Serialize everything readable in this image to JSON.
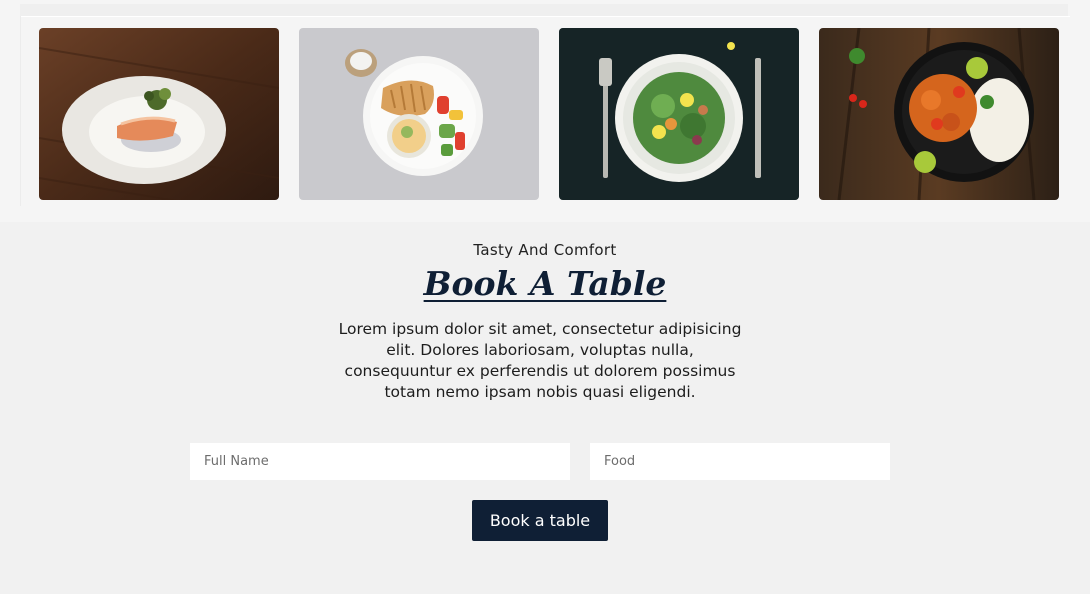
{
  "gallery": {
    "images": [
      {
        "icon": "salmon-dish-photo"
      },
      {
        "icon": "chicken-salad-plate-photo"
      },
      {
        "icon": "green-salad-plate-photo"
      },
      {
        "icon": "curry-rice-plate-photo"
      }
    ]
  },
  "booking": {
    "eyebrow": "Tasty And Comfort",
    "title": "Book A Table",
    "description": "Lorem ipsum dolor sit amet, consectetur adipisicing elit. Dolores laboriosam, voluptas nulla, consequuntur ex perferendis ut dolorem possimus totam nemo ipsam nobis quasi eligendi.",
    "fields": {
      "name_placeholder": "Full Name",
      "name_value": "",
      "food_placeholder": "Food",
      "food_value": ""
    },
    "submit_label": "Book a table"
  },
  "colors": {
    "accent": "#0f1f35",
    "background": "#f1f1f1"
  }
}
